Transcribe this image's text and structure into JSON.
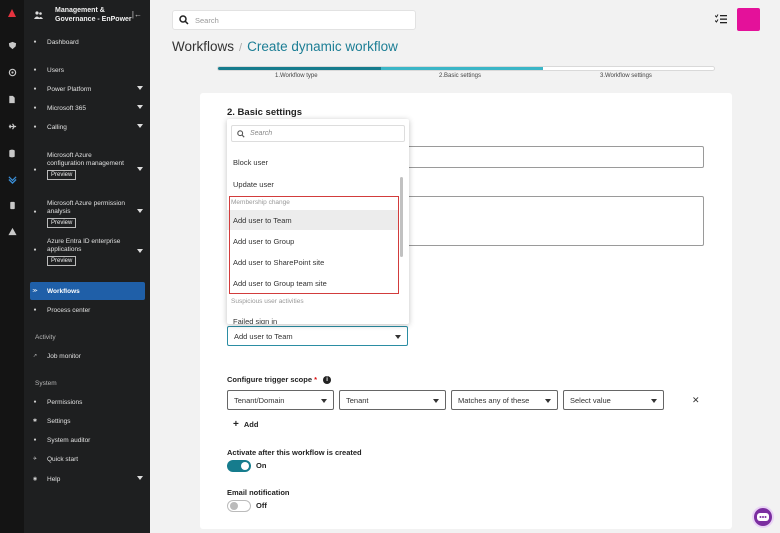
{
  "sidebar": {
    "title_line1": "Management &",
    "title_line2": "Governance - EnPower",
    "items": {
      "dashboard": "Dashboard",
      "users": "Users",
      "power_platform": "Power Platform",
      "microsoft365": "Microsoft 365",
      "calling": "Calling",
      "azure_config": "Microsoft Azure configuration management",
      "azure_perm": "Microsoft Azure permission analysis",
      "entra": "Azure Entra ID enterprise applications",
      "preview": "Preview",
      "workflows": "Workflows",
      "process_center": "Process center",
      "activity_section": "Activity",
      "job_monitor": "Job monitor",
      "system_section": "System",
      "permissions": "Permissions",
      "settings": "Settings",
      "system_auditor": "System auditor",
      "quick_start": "Quick start",
      "help": "Help"
    }
  },
  "topbar": {
    "search_placeholder": "Search",
    "avatar_color": "#e4119a"
  },
  "breadcrumb": {
    "root": "Workflows",
    "separator": "/",
    "current": "Create dynamic workflow"
  },
  "stepper": {
    "steps": [
      "1.Workflow type",
      "2.Basic settings",
      "3.Workflow settings"
    ],
    "current_step": 2
  },
  "form": {
    "section_title": "2. Basic settings",
    "selected_action": "Add user to Team",
    "trigger_scope_label": "Configure trigger scope",
    "required_mark": "*",
    "info_glyph": "i",
    "scope_selects": [
      "Tenant/Domain",
      "Tenant",
      "Matches any of these",
      "Select value"
    ],
    "remove_glyph": "✕",
    "add_label": "Add",
    "activate_label": "Activate after this workflow is created",
    "activate_state": "On",
    "email_label": "Email notification",
    "email_state": "Off"
  },
  "dropdown": {
    "search_placeholder": "Search",
    "items_top": [
      "Block user",
      "Update user"
    ],
    "group_membership": "Membership change",
    "membership_items": [
      "Add user to Team",
      "Add user to Group",
      "Add user to SharePoint site",
      "Add user to Group team site"
    ],
    "group_suspicious": "Suspicious user activities",
    "partial_item": "Failed sign in"
  },
  "colors": {
    "accent_teal": "#167c8d",
    "accent_light": "#3bb6c7",
    "active_nav": "#1f5fa8",
    "highlight_box": "#d23c3c"
  }
}
